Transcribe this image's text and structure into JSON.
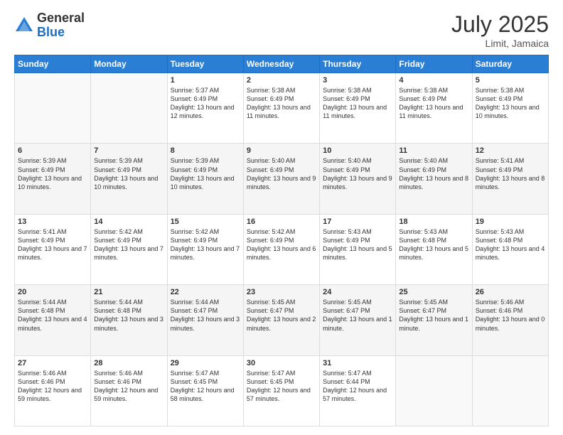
{
  "header": {
    "logo_general": "General",
    "logo_blue": "Blue",
    "month": "July 2025",
    "location": "Limit, Jamaica"
  },
  "days_of_week": [
    "Sunday",
    "Monday",
    "Tuesday",
    "Wednesday",
    "Thursday",
    "Friday",
    "Saturday"
  ],
  "weeks": [
    [
      {
        "day": "",
        "info": ""
      },
      {
        "day": "",
        "info": ""
      },
      {
        "day": "1",
        "info": "Sunrise: 5:37 AM\nSunset: 6:49 PM\nDaylight: 13 hours and 12 minutes."
      },
      {
        "day": "2",
        "info": "Sunrise: 5:38 AM\nSunset: 6:49 PM\nDaylight: 13 hours and 11 minutes."
      },
      {
        "day": "3",
        "info": "Sunrise: 5:38 AM\nSunset: 6:49 PM\nDaylight: 13 hours and 11 minutes."
      },
      {
        "day": "4",
        "info": "Sunrise: 5:38 AM\nSunset: 6:49 PM\nDaylight: 13 hours and 11 minutes."
      },
      {
        "day": "5",
        "info": "Sunrise: 5:38 AM\nSunset: 6:49 PM\nDaylight: 13 hours and 10 minutes."
      }
    ],
    [
      {
        "day": "6",
        "info": "Sunrise: 5:39 AM\nSunset: 6:49 PM\nDaylight: 13 hours and 10 minutes."
      },
      {
        "day": "7",
        "info": "Sunrise: 5:39 AM\nSunset: 6:49 PM\nDaylight: 13 hours and 10 minutes."
      },
      {
        "day": "8",
        "info": "Sunrise: 5:39 AM\nSunset: 6:49 PM\nDaylight: 13 hours and 10 minutes."
      },
      {
        "day": "9",
        "info": "Sunrise: 5:40 AM\nSunset: 6:49 PM\nDaylight: 13 hours and 9 minutes."
      },
      {
        "day": "10",
        "info": "Sunrise: 5:40 AM\nSunset: 6:49 PM\nDaylight: 13 hours and 9 minutes."
      },
      {
        "day": "11",
        "info": "Sunrise: 5:40 AM\nSunset: 6:49 PM\nDaylight: 13 hours and 8 minutes."
      },
      {
        "day": "12",
        "info": "Sunrise: 5:41 AM\nSunset: 6:49 PM\nDaylight: 13 hours and 8 minutes."
      }
    ],
    [
      {
        "day": "13",
        "info": "Sunrise: 5:41 AM\nSunset: 6:49 PM\nDaylight: 13 hours and 7 minutes."
      },
      {
        "day": "14",
        "info": "Sunrise: 5:42 AM\nSunset: 6:49 PM\nDaylight: 13 hours and 7 minutes."
      },
      {
        "day": "15",
        "info": "Sunrise: 5:42 AM\nSunset: 6:49 PM\nDaylight: 13 hours and 7 minutes."
      },
      {
        "day": "16",
        "info": "Sunrise: 5:42 AM\nSunset: 6:49 PM\nDaylight: 13 hours and 6 minutes."
      },
      {
        "day": "17",
        "info": "Sunrise: 5:43 AM\nSunset: 6:49 PM\nDaylight: 13 hours and 5 minutes."
      },
      {
        "day": "18",
        "info": "Sunrise: 5:43 AM\nSunset: 6:48 PM\nDaylight: 13 hours and 5 minutes."
      },
      {
        "day": "19",
        "info": "Sunrise: 5:43 AM\nSunset: 6:48 PM\nDaylight: 13 hours and 4 minutes."
      }
    ],
    [
      {
        "day": "20",
        "info": "Sunrise: 5:44 AM\nSunset: 6:48 PM\nDaylight: 13 hours and 4 minutes."
      },
      {
        "day": "21",
        "info": "Sunrise: 5:44 AM\nSunset: 6:48 PM\nDaylight: 13 hours and 3 minutes."
      },
      {
        "day": "22",
        "info": "Sunrise: 5:44 AM\nSunset: 6:47 PM\nDaylight: 13 hours and 3 minutes."
      },
      {
        "day": "23",
        "info": "Sunrise: 5:45 AM\nSunset: 6:47 PM\nDaylight: 13 hours and 2 minutes."
      },
      {
        "day": "24",
        "info": "Sunrise: 5:45 AM\nSunset: 6:47 PM\nDaylight: 13 hours and 1 minute."
      },
      {
        "day": "25",
        "info": "Sunrise: 5:45 AM\nSunset: 6:47 PM\nDaylight: 13 hours and 1 minute."
      },
      {
        "day": "26",
        "info": "Sunrise: 5:46 AM\nSunset: 6:46 PM\nDaylight: 13 hours and 0 minutes."
      }
    ],
    [
      {
        "day": "27",
        "info": "Sunrise: 5:46 AM\nSunset: 6:46 PM\nDaylight: 12 hours and 59 minutes."
      },
      {
        "day": "28",
        "info": "Sunrise: 5:46 AM\nSunset: 6:46 PM\nDaylight: 12 hours and 59 minutes."
      },
      {
        "day": "29",
        "info": "Sunrise: 5:47 AM\nSunset: 6:45 PM\nDaylight: 12 hours and 58 minutes."
      },
      {
        "day": "30",
        "info": "Sunrise: 5:47 AM\nSunset: 6:45 PM\nDaylight: 12 hours and 57 minutes."
      },
      {
        "day": "31",
        "info": "Sunrise: 5:47 AM\nSunset: 6:44 PM\nDaylight: 12 hours and 57 minutes."
      },
      {
        "day": "",
        "info": ""
      },
      {
        "day": "",
        "info": ""
      }
    ]
  ]
}
